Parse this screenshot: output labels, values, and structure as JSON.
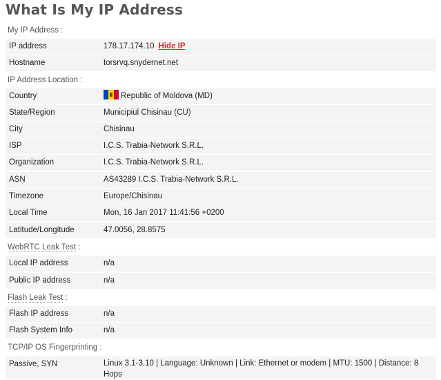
{
  "title": "What Is My IP Address",
  "sections": {
    "my_ip": "My IP Address :",
    "location": "IP Address Location :",
    "webrtc_label": "WebRTC Leak Test",
    "flash_label": "Flash Leak Test",
    "tcpip": "TCP/IP OS Fingerprinting :",
    "colon": " :"
  },
  "rows": {
    "ip": {
      "key": "IP address",
      "value": "178.17.174.10",
      "action": "Hide IP"
    },
    "hostname": {
      "key": "Hostname",
      "value": "torsrvq.snydernet.net"
    },
    "country": {
      "key": "Country",
      "value": "Republic of Moldova (MD)",
      "flag": "moldova-flag-icon"
    },
    "state": {
      "key": "State/Region",
      "value": "Municipiul Chisinau (CU)"
    },
    "city": {
      "key": "City",
      "value": "Chisinau"
    },
    "isp": {
      "key": "ISP",
      "value": "I.C.S. Trabia-Network S.R.L."
    },
    "organization": {
      "key": "Organization",
      "value": "I.C.S. Trabia-Network S.R.L."
    },
    "asn": {
      "key": "ASN",
      "value": "AS43289 I.C.S. Trabia-Network S.R.L."
    },
    "timezone": {
      "key": "Timezone",
      "value": "Europe/Chisinau"
    },
    "localtime": {
      "key": "Local Time",
      "value": "Mon, 16 Jan 2017 11:41:56 +0200"
    },
    "latlon": {
      "key": "Latitude/Longitude",
      "value": "47.0056, 28.8575"
    },
    "local_ip": {
      "key": "Local IP address",
      "value": "n/a"
    },
    "public_ip": {
      "key": "Public IP address",
      "value": "n/a"
    },
    "flash_ip": {
      "key": "Flash IP address",
      "value": "n/a"
    },
    "flash_sys": {
      "key": "Flash System Info",
      "value": "n/a"
    },
    "passive": {
      "key": "Passive, SYN",
      "value": "Linux 3.1-3.10 | Language: Unknown | Link: Ethernet or modem | MTU: 1500 | Distance: 8 Hops"
    }
  },
  "colors": {
    "hide_ip": "#d12b2b",
    "row_bg": "#f4f4f4",
    "title": "#555555"
  }
}
